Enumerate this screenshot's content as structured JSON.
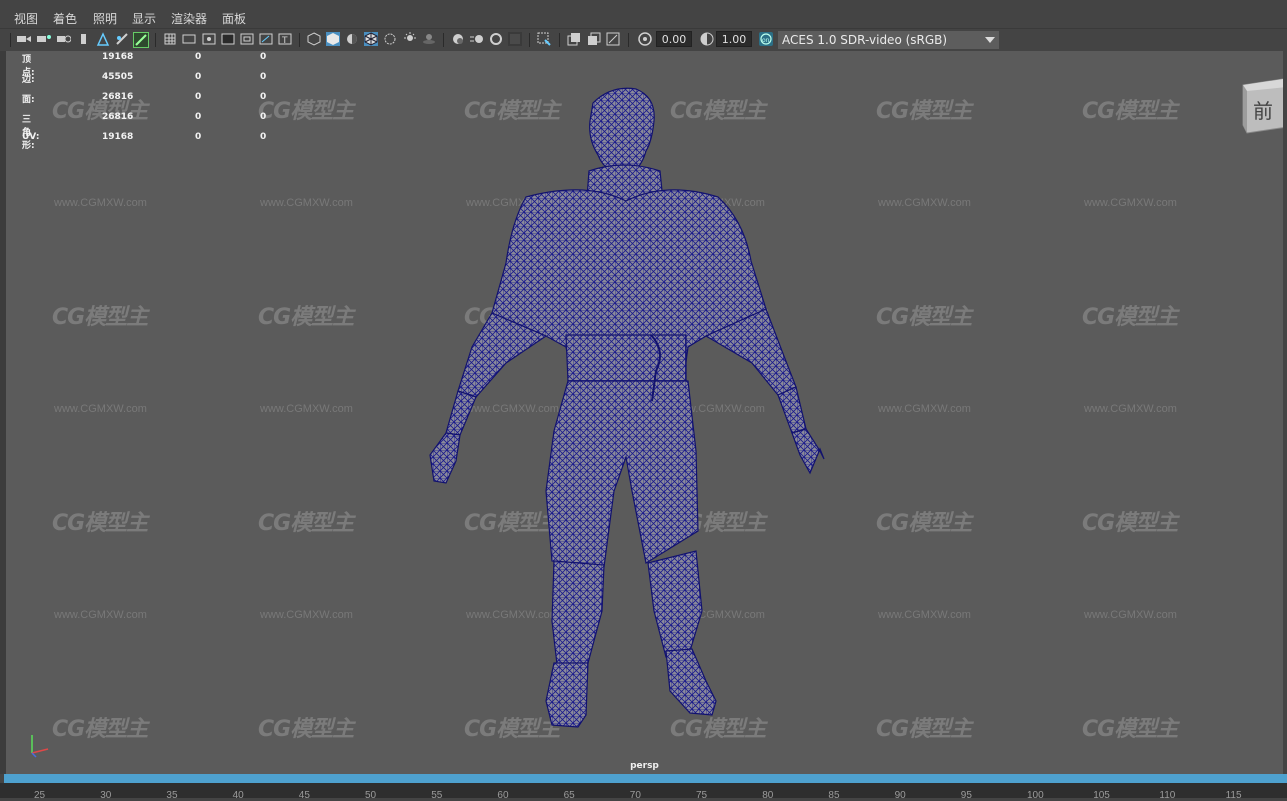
{
  "menu": [
    "视图",
    "着色",
    "照明",
    "显示",
    "渲染器",
    "面板"
  ],
  "toolbar": {
    "exposure": "0.00",
    "gamma": "1.00",
    "colorspace": "ACES 1.0 SDR-video (sRGB)"
  },
  "hud": [
    {
      "label": "顶点:",
      "v1": "19168",
      "v2": "0",
      "v3": "0"
    },
    {
      "label": "边:",
      "v1": "45505",
      "v2": "0",
      "v3": "0"
    },
    {
      "label": "面:",
      "v1": "26816",
      "v2": "0",
      "v3": "0"
    },
    {
      "label": "三角形:",
      "v1": "26816",
      "v2": "0",
      "v3": "0"
    },
    {
      "label": "UV:",
      "v1": "19168",
      "v2": "0",
      "v3": "0"
    }
  ],
  "viewcube_label": "前",
  "camera_label": "persp",
  "watermark": {
    "logo": "CG模型主",
    "url": "www.CGMXW.com"
  },
  "ruler_ticks": [
    "25",
    "30",
    "35",
    "40",
    "45",
    "50",
    "55",
    "60",
    "65",
    "70",
    "75",
    "80",
    "85",
    "90",
    "95",
    "100",
    "105",
    "110",
    "115"
  ],
  "colors": {
    "wireframe": "#1a1a8c",
    "timebar": "#4ea1cf",
    "viewport": "#5b5b5b"
  }
}
